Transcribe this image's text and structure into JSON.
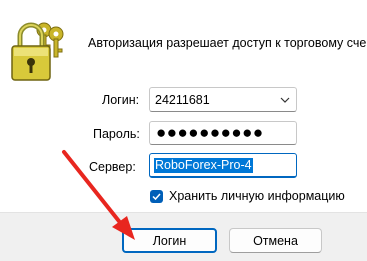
{
  "intro_text": "Авторизация разрешает доступ к торговому сче",
  "fields": {
    "login_label": "Логин:",
    "login_value": "24211681",
    "password_label": "Пароль:",
    "password_value": "●●●●●●●●●●",
    "server_label": "Сервер:",
    "server_value": "RoboForex-Pro-4"
  },
  "save_info": {
    "label": "Хранить личную информацию",
    "checked": true
  },
  "buttons": {
    "login": "Логин",
    "cancel": "Отмена"
  },
  "icons": {
    "lock": "padlock-with-keys-icon",
    "dropdown": "chevron-down-icon",
    "checkmark": "check-icon",
    "annotation": "red-arrow"
  },
  "colors": {
    "accent": "#0067c0",
    "selection": "#0078d7",
    "annotation_arrow": "#e8261f",
    "lock_gold": "#d8c93a"
  }
}
